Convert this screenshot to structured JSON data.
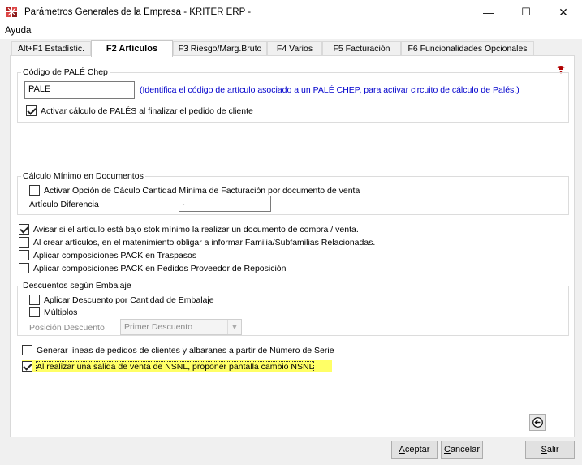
{
  "window": {
    "title": "Parámetros Generales de la Empresa - KRITER ERP -",
    "minimize": "—",
    "maximize": "☐",
    "close": "✕"
  },
  "menu": {
    "ayuda": "Ayuda"
  },
  "tabs": [
    {
      "label": "Alt+F1 Estadístic."
    },
    {
      "label": "F2 Artículos"
    },
    {
      "label": "F3 Riesgo/Marg.Bruto"
    },
    {
      "label": "F4 Varios"
    },
    {
      "label": "F5 Facturación"
    },
    {
      "label": "F6 Funcionalidades Opcionales"
    }
  ],
  "active_tab": "F2 Artículos",
  "pale": {
    "group_title": "Código de PALÉ Chep",
    "code_value": "PALE",
    "hint": "(Identifica el código de artículo asociado a un PALÉ CHEP, para activar circuito de cálculo de Palés.)",
    "activar_label": "Activar cálculo de PALÉS al finalizar el pedido de cliente",
    "activar_checked": true
  },
  "calculo_minimo": {
    "group_title": "Cálculo Mínimo en Documentos",
    "activar_label": "Activar Opción de Cáculo Cantidad Mínima de Facturación por documento de venta",
    "activar_checked": false,
    "articulo_label": "Artículo Diferencia",
    "articulo_value": "."
  },
  "options": [
    {
      "label": "Avisar si el artículo está bajo stok mínimo la realizar un documento de compra / venta.",
      "checked": true
    },
    {
      "label": "Al crear artículos, en el matenimiento obligar a informar Familia/Subfamilias Relacionadas.",
      "checked": false
    },
    {
      "label": "Aplicar composiciones PACK en Traspasos",
      "checked": false
    },
    {
      "label": "Aplicar composiciones PACK en Pedidos Proveedor de Reposición",
      "checked": false
    }
  ],
  "descuentos": {
    "group_title": "Descuentos según Embalaje",
    "aplicar_label": "Aplicar Descuento por Cantidad de Embalaje",
    "aplicar_checked": false,
    "multiplos_label": "Múltiplos",
    "multiplos_checked": false,
    "posicion_label": "Posición Descuento",
    "posicion_value": "Primer Descuento"
  },
  "serie": {
    "label": "Generar líneas de pedidos de clientes y albaranes a partir de Número de Serie",
    "checked": false
  },
  "nsnl": {
    "label": "Al realizar una salida de venta de NSNL, proponer pantalla cambio  NSNL",
    "checked": true,
    "highlight_color": "#ffff66"
  },
  "buttons": {
    "aceptar_u": "A",
    "aceptar_rest": "ceptar",
    "cancelar_u": "C",
    "cancelar_rest": "ancelar",
    "salir_u": "S",
    "salir_rest": "alir"
  },
  "icons": {
    "app": "kriter-app-icon",
    "help": "help-icon",
    "back": "back-arrow-icon"
  }
}
